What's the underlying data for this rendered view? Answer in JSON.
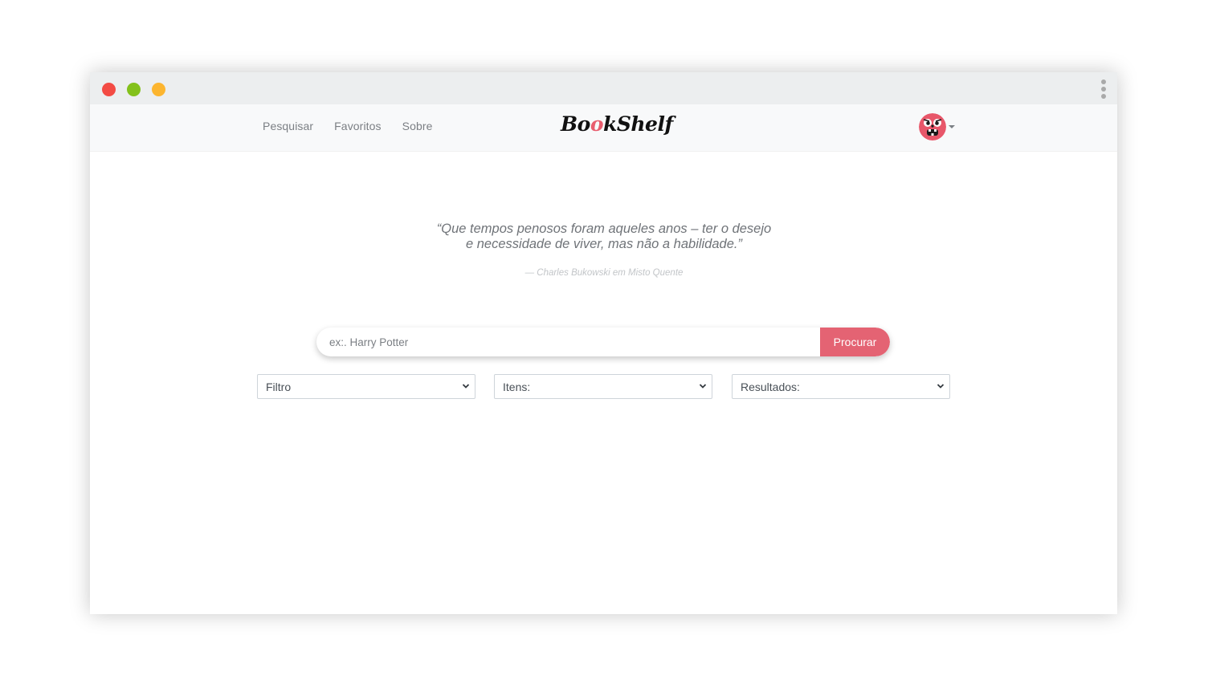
{
  "window": {
    "controls": {
      "close_color": "#f34b44",
      "minimize_color": "#83c11b",
      "zoom_color": "#fcb52f"
    },
    "menu_icon": "kebab-menu-icon"
  },
  "navbar": {
    "links": [
      "Pesquisar",
      "Favoritos",
      "Sobre"
    ],
    "brand": {
      "part1": "Bo",
      "part2": "o",
      "part3": "kShelf"
    },
    "avatar_icon": "monster-avatar-icon",
    "accent_color": "#e85d6e"
  },
  "quote": {
    "text": "“Que tempos penosos foram aqueles anos – ter o desejo e necessidade de viver, mas não a habilidade.”",
    "author": "— Charles Bukowski em Misto Quente"
  },
  "search": {
    "placeholder": "ex:. Harry Potter",
    "value": "",
    "button_label": "Procurar",
    "button_color": "#e46373"
  },
  "filters": {
    "filter": {
      "selected": "Filtro"
    },
    "items": {
      "selected": "Itens:"
    },
    "results": {
      "selected": "Resultados:"
    }
  }
}
